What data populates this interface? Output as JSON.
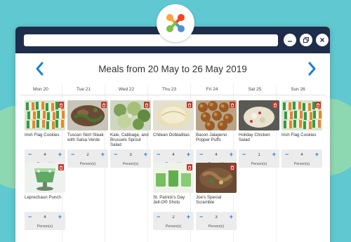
{
  "browser": {
    "address_value": ""
  },
  "header": {
    "title": "Meals from 20 May to 26 May 2019"
  },
  "colors": {
    "titlebar": "#1f2d4a",
    "accent": "#1a7fd4",
    "delete": "#c0392b",
    "background": "#5fc8d0"
  },
  "days": [
    "Mon 20",
    "Tue 21",
    "Wed 22",
    "Thu 23",
    "Fri 24",
    "Sat 25",
    "Sun 26"
  ],
  "meals": [
    [
      {
        "name": "Irish Flag Cookies",
        "qty": "4",
        "unit": "Person(s)",
        "photo": "cookies"
      },
      {
        "name": "Leprechaun Punch",
        "qty": "4",
        "unit": "Person(s)",
        "photo": "punch"
      }
    ],
    [
      {
        "name": "Tuscan Skirt Steak with Salsa Verde",
        "qty": "2",
        "unit": "Person(s)",
        "photo": "steak"
      }
    ],
    [
      {
        "name": "Kale, Cabbage, and Brussels Sprout Salad",
        "qty": "3",
        "unit": "Person(s)",
        "photo": "salad"
      }
    ],
    [
      {
        "name": "Chilean Dobladitas",
        "qty": "4",
        "unit": "Person(s)",
        "photo": "bread"
      },
      {
        "name": "St. Patrick's Day Jell-O® Shots",
        "qty": "2",
        "unit": "Person(s)",
        "photo": "shots"
      }
    ],
    [
      {
        "name": "Bacon Jalapeno Popper Puffs",
        "qty": "4",
        "unit": "Person(s)",
        "photo": "puffs"
      },
      {
        "name": "Joe's Special Scramble",
        "qty": "3",
        "unit": "Person(s)",
        "photo": "scramble"
      }
    ],
    [
      {
        "name": "Holiday Chicken Salad",
        "qty": "1",
        "unit": "Person(s)",
        "photo": "chicken"
      }
    ],
    [
      {
        "name": "Irish Flag Cookies",
        "qty": "4",
        "unit": "Person(s)",
        "photo": "cookies"
      }
    ]
  ]
}
